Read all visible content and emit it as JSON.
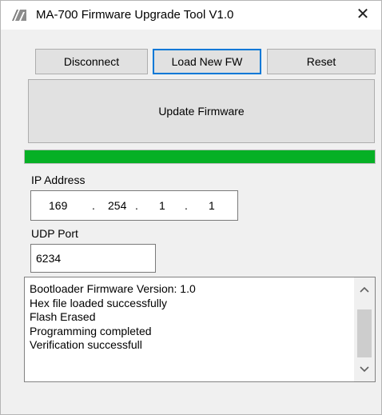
{
  "window": {
    "title": "MA-700 Firmware Upgrade Tool V1.0",
    "close_symbol": "✕",
    "icon": "app-logo-icon"
  },
  "toolbar": {
    "disconnect_label": "Disconnect",
    "load_fw_label": "Load New FW",
    "reset_label": "Reset"
  },
  "update_label": "Update Firmware",
  "progress": {
    "value_percent": 100,
    "color": "#06b025"
  },
  "ip": {
    "label": "IP Address",
    "octets": [
      "169",
      "254",
      "1",
      "1"
    ],
    "separator": "."
  },
  "udp": {
    "label": "UDP Port",
    "value": "6234"
  },
  "log": {
    "lines": [
      "Bootloader Firmware Version: 1.0",
      "Hex file loaded successfully",
      "Flash Erased",
      "Programming completed",
      "Verification successfull"
    ]
  },
  "icons": {
    "scroll_up": "chevron-up-icon",
    "scroll_down": "chevron-down-icon"
  },
  "colors": {
    "focus_border": "#0078d7",
    "progress_green": "#06b025"
  }
}
